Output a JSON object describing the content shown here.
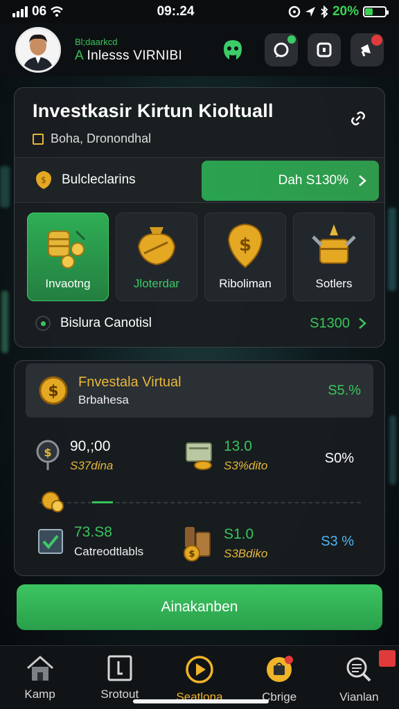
{
  "status_bar": {
    "carrier": "06",
    "time": "09:.24",
    "battery_percent": "20%"
  },
  "header": {
    "subtitle": "Bl;daarkcd",
    "name_prefix": "A",
    "name_rest": "Inlesss VIRNIBI"
  },
  "card": {
    "title": "Investkasir Kirtun Kioltuall",
    "subtitle": "Boha, Dronondhal",
    "balance_label": "Bulcleclarins",
    "balance_button": "Dah S130%",
    "tiles": [
      {
        "label": "Invaotng",
        "active": true
      },
      {
        "label": "Jloterdar",
        "active": false
      },
      {
        "label": "Riboliman",
        "active": false
      },
      {
        "label": "Sotlers",
        "active": false
      }
    ],
    "capital_label": "Bislura Canotisl",
    "capital_value": "S1300"
  },
  "virtual": {
    "title": "Fnvestala Virtual",
    "subtitle": "Brbahesa",
    "percent": "S5.%",
    "stats": [
      {
        "value": "90,;00",
        "sub": "S37dina",
        "value2": "13.0",
        "sub2": "S3%dito",
        "pct": "S0%",
        "pct_color": "#ffffff"
      },
      {
        "value": "73.S8",
        "sub": "Catreodtlabls",
        "value2": "S1.0",
        "sub2": "S3Bdiko",
        "pct": "S3 %",
        "pct_color": "#4fb6f0"
      }
    ]
  },
  "cta_label": "Ainakanben",
  "nav": [
    {
      "label": "Kamp",
      "icon": "home-icon"
    },
    {
      "label": "Srotout",
      "icon": "flag-icon"
    },
    {
      "label": "Seatlona",
      "icon": "play-icon",
      "active": true
    },
    {
      "label": "Cbrige",
      "icon": "bag-icon"
    },
    {
      "label": "Vianlan",
      "icon": "search-icon"
    }
  ],
  "colors": {
    "accent_green": "#39c45b",
    "accent_gold": "#e5b73a",
    "nav_active": "#f0b429",
    "blue_percent": "#4fb6f0"
  }
}
